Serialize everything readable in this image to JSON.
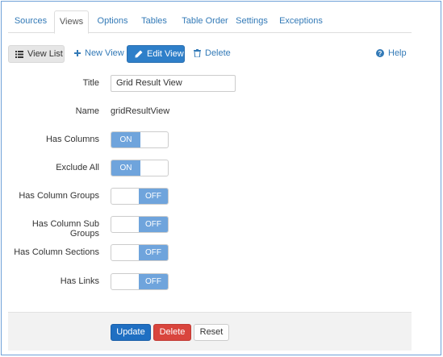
{
  "tabs": [
    {
      "label": "Sources",
      "active": false
    },
    {
      "label": "Views",
      "active": true
    },
    {
      "label": "Options",
      "active": false
    },
    {
      "label": "Tables",
      "active": false
    },
    {
      "label": "Table Order",
      "active": false
    },
    {
      "label": "Settings",
      "active": false
    },
    {
      "label": "Exceptions",
      "active": false
    }
  ],
  "toolbar": {
    "view_list_label": "View List",
    "new_view_label": "New View",
    "edit_view_label": "Edit View",
    "delete_label": "Delete",
    "help_label": "Help",
    "icons": {
      "view_list": "list-icon",
      "new_view": "plus-icon",
      "edit_view": "pencil-icon",
      "delete": "trash-icon",
      "help": "question-circle-icon"
    }
  },
  "form": {
    "title": {
      "label": "Title",
      "value": "Grid Result View"
    },
    "name": {
      "label": "Name",
      "value": "gridResultView"
    },
    "toggles": [
      {
        "label": "Has Columns",
        "state": "on",
        "text": "ON"
      },
      {
        "label": "Exclude All",
        "state": "on",
        "text": "ON"
      },
      {
        "label": "Has Column Groups",
        "state": "off",
        "text": "OFF"
      },
      {
        "label": "Has Column Sub Groups",
        "state": "off",
        "text": "OFF"
      },
      {
        "label": "Has Column Sections",
        "state": "off",
        "text": "OFF"
      },
      {
        "label": "Has Links",
        "state": "off",
        "text": "OFF"
      }
    ]
  },
  "footer": {
    "update_label": "Update",
    "delete_label": "Delete",
    "reset_label": "Reset"
  },
  "colors": {
    "accent": "#2e7fc9",
    "toggle": "#6fa4dc",
    "danger": "#d9453d",
    "link": "#337ab7"
  }
}
